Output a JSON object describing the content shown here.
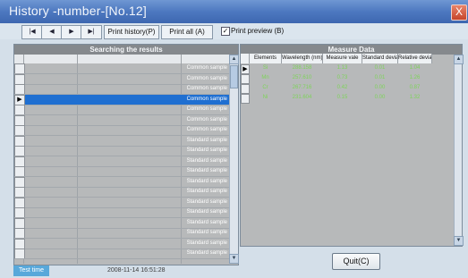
{
  "window": {
    "title": "History -number-[No.12]",
    "close_glyph": "X"
  },
  "toolbar": {
    "nav": [
      {
        "icon": "first-record-icon",
        "glyph": "|◀"
      },
      {
        "icon": "previous-record-icon",
        "glyph": "◀"
      },
      {
        "icon": "next-record-icon",
        "glyph": "▶"
      },
      {
        "icon": "last-record-icon",
        "glyph": "▶|"
      }
    ],
    "print_history": "Print history(P)",
    "print_all": "Print all (A)",
    "print_preview": "Print preview (B)",
    "print_preview_checked": true
  },
  "search_panel": {
    "header": "Searching the results",
    "rows": [
      "Common sample",
      "Common sample",
      "Common sample",
      "Common sample",
      "Common sample",
      "Common sample",
      "Common sample",
      "Standard sample",
      "Standard sample",
      "Standard sample",
      "Standard sample",
      "Standard sample",
      "Standard sample",
      "Standard sample",
      "Standard sample",
      "Standard sample",
      "Standard sample",
      "Standard sample",
      "Standard sample"
    ],
    "selected_index": 3
  },
  "measure_panel": {
    "header": "Measure Data",
    "columns": [
      "Elements",
      "Wavelength (nm)",
      "Measure vale",
      "Standard deviation",
      "Relative deviation"
    ],
    "rows": [
      [
        "Si",
        "288.158",
        "1.13",
        "0.01",
        "1.04"
      ],
      [
        "Mn",
        "257.610",
        "0.73",
        "0.01",
        "1.26"
      ],
      [
        "Cr",
        "267.716",
        "0.42",
        "0.00",
        "0.87"
      ],
      [
        "Ni",
        "231.604",
        "0.15",
        "0.00",
        "1.32"
      ]
    ]
  },
  "status": {
    "label": "Test time",
    "value": "2008-11-14 16:51:28"
  },
  "quit_button": "Quit(C)",
  "colors": {
    "title_bar": "#4d78c0",
    "selection": "#1f6fd1",
    "measure_text": "#7ed35a"
  }
}
